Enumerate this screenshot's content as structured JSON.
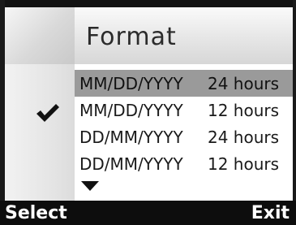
{
  "header": {
    "title": "Format"
  },
  "options": [
    {
      "date": "MM/DD/YYYY",
      "time": "24 hours",
      "highlighted": true,
      "checked": false
    },
    {
      "date": "MM/DD/YYYY",
      "time": "12 hours",
      "highlighted": false,
      "checked": true
    },
    {
      "date": "DD/MM/YYYY",
      "time": "24 hours",
      "highlighted": false,
      "checked": false
    },
    {
      "date": "DD/MM/YYYY",
      "time": "12 hours",
      "highlighted": false,
      "checked": false
    }
  ],
  "indicators": {
    "checkmark_icon": "check-icon",
    "scroll_icon": "arrow-down-icon"
  },
  "softkeys": {
    "left": "Select",
    "right": "Exit"
  },
  "colors": {
    "highlight": "#9a9a9a",
    "softbar": "#0d0d0d"
  }
}
